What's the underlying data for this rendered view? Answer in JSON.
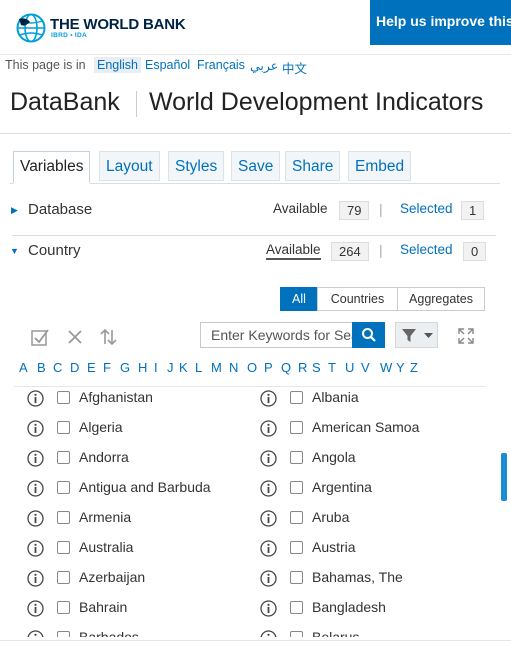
{
  "header": {
    "logo_title": "THE WORLD BANK",
    "logo_sub": "IBRD • IDA",
    "help_label": "Help us improve this site"
  },
  "language_bar": {
    "label": "This page is in",
    "languages": [
      "English",
      "Español",
      "Français",
      "عربي",
      "中文"
    ],
    "active": "English"
  },
  "title": {
    "app": "DataBank",
    "database": "World Development Indicators"
  },
  "tabs": [
    "Variables",
    "Layout",
    "Styles",
    "Save",
    "Share",
    "Embed"
  ],
  "active_tab": "Variables",
  "sections": {
    "database": {
      "title": "Database",
      "available_label": "Available",
      "available_count": "79",
      "selected_label": "Selected",
      "selected_count": "1",
      "separator": "|"
    },
    "country": {
      "title": "Country",
      "available_label": "Available",
      "available_count": "264",
      "selected_label": "Selected",
      "selected_count": "0",
      "separator": "|"
    }
  },
  "filter_buttons": [
    "All",
    "Countries",
    "Aggregates"
  ],
  "active_filter": "All",
  "search": {
    "placeholder": "Enter Keywords for Search"
  },
  "alphabet": [
    "A",
    "B",
    "C",
    "D",
    "E",
    "F",
    "G",
    "H",
    "I",
    "J",
    "K",
    "L",
    "M",
    "N",
    "O",
    "P",
    "Q",
    "R",
    "S",
    "T",
    "U",
    "V",
    "W",
    "Y",
    "Z"
  ],
  "countries_left": [
    "Afghanistan",
    "Algeria",
    "Andorra",
    "Antigua and Barbuda",
    "Armenia",
    "Australia",
    "Azerbaijan",
    "Bahrain",
    "Barbados"
  ],
  "countries_right": [
    "Albania",
    "American Samoa",
    "Angola",
    "Argentina",
    "Aruba",
    "Austria",
    "Bahamas, The",
    "Bangladesh",
    "Belarus"
  ],
  "colors": {
    "brand_blue": "#0071bc",
    "navy": "#002244",
    "light_blue": "#009fda"
  }
}
